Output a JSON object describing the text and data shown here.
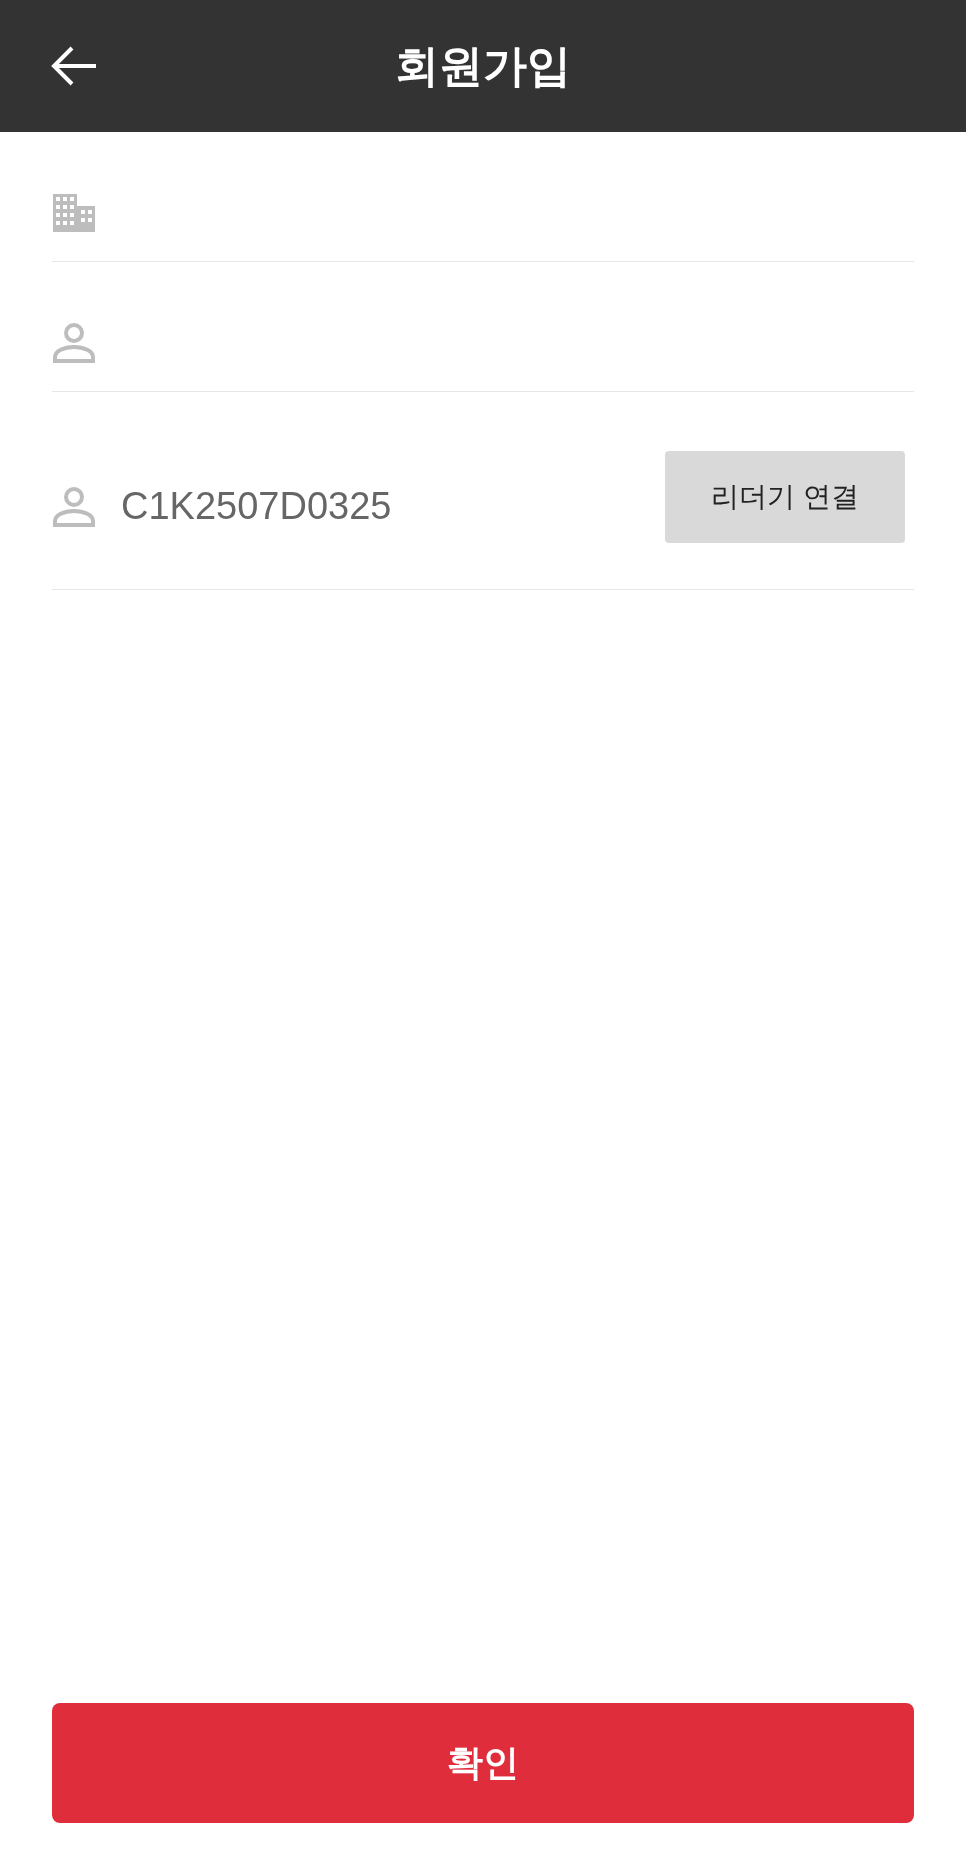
{
  "header": {
    "title": "회원가입"
  },
  "fields": [
    {
      "kind": "building"
    },
    {
      "kind": "person"
    },
    {
      "kind": "person",
      "value": "C1K2507D0325",
      "button": "리더기 연결"
    }
  ],
  "confirm_button": "확인"
}
